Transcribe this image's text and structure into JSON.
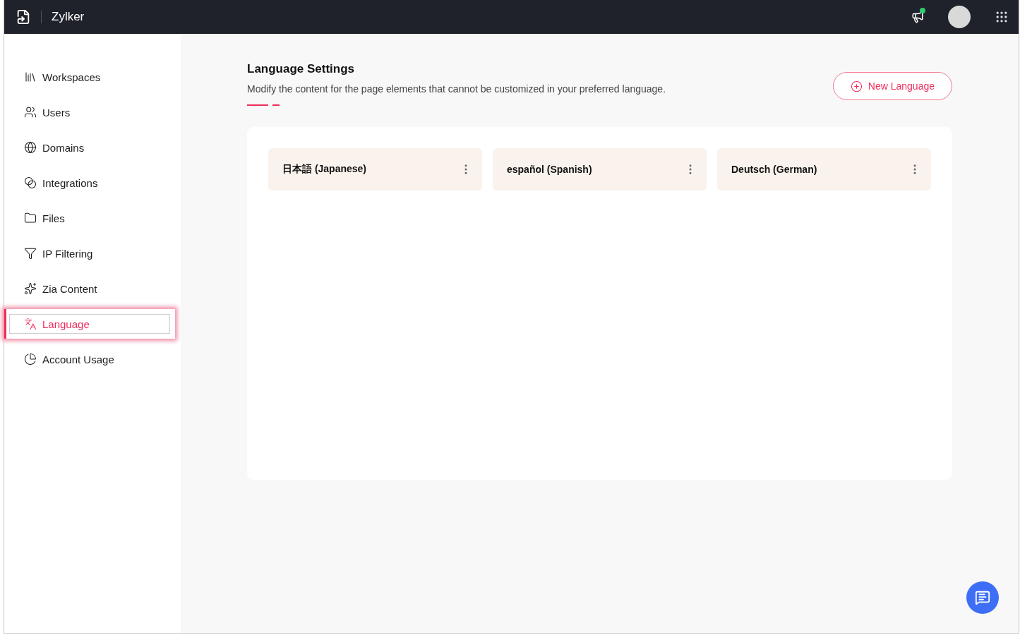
{
  "topbar": {
    "brand": "Zylker",
    "notification": true
  },
  "sidebar": {
    "items": [
      {
        "label": "Workspaces",
        "selected": false
      },
      {
        "label": "Users",
        "selected": false
      },
      {
        "label": "Domains",
        "selected": false
      },
      {
        "label": "Integrations",
        "selected": false
      },
      {
        "label": "Files",
        "selected": false
      },
      {
        "label": "IP Filtering",
        "selected": false
      },
      {
        "label": "Zia Content",
        "selected": false
      },
      {
        "label": "Language",
        "selected": true
      },
      {
        "label": "Account Usage",
        "selected": false
      }
    ]
  },
  "header": {
    "title": "Language Settings",
    "description": "Modify the content for the page elements that cannot be customized in your preferred language.",
    "button": "New Language"
  },
  "languages": [
    {
      "label": "日本語 (Japanese)"
    },
    {
      "label": "español (Spanish)"
    },
    {
      "label": "Deutsch (German)"
    }
  ]
}
